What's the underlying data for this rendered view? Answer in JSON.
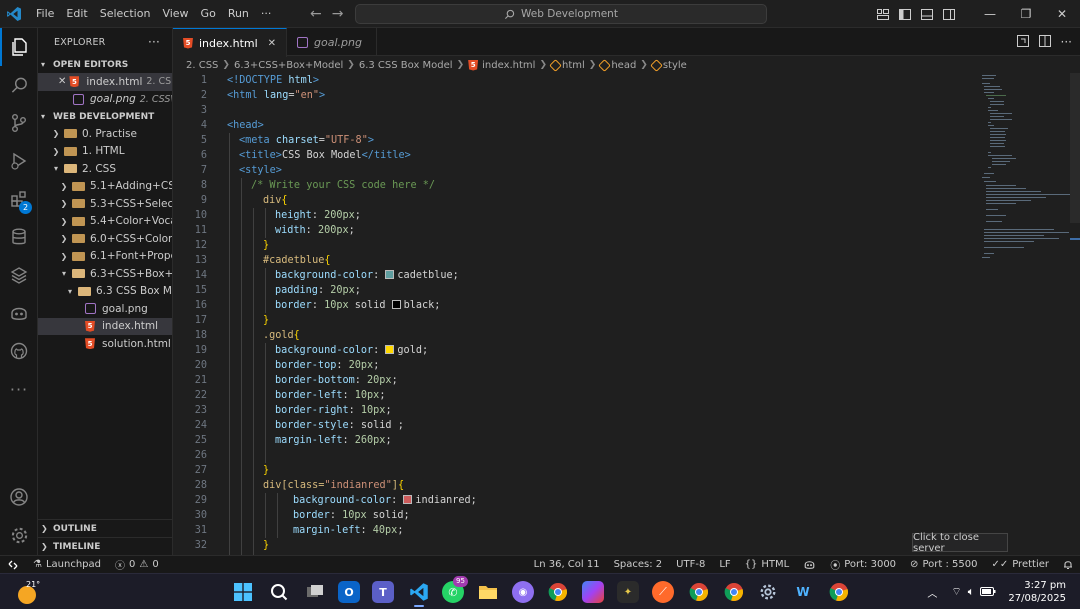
{
  "menu": [
    "File",
    "Edit",
    "Selection",
    "View",
    "Go",
    "Run",
    "···"
  ],
  "search": {
    "text": "Web Development"
  },
  "explorer": {
    "header": "EXPLORER",
    "open_editors_label": "OPEN EDITORS",
    "open_editors": [
      {
        "name": "index.html",
        "desc": "2. CS..."
      },
      {
        "name": "goal.png",
        "desc": "2. CSS\\..."
      }
    ],
    "workspace_label": "WEB DEVELOPMENT",
    "tree": [
      "0. Practise",
      "1. HTML",
      "2. CSS",
      "5.1+Adding+CSS",
      "5.3+CSS+Select...",
      "5.4+Color+Voca...",
      "6.0+CSS+Colors",
      "6.1+Font+Prope...",
      "6.3+CSS+Box+...",
      "6.3 CSS Box M...",
      "goal.png",
      "index.html",
      "solution.html"
    ],
    "outline_label": "OUTLINE",
    "timeline_label": "TIMELINE"
  },
  "tabs": [
    {
      "label": "index.html",
      "close": "✕"
    },
    {
      "label": "goal.png"
    }
  ],
  "breadcrumbs": [
    "2. CSS",
    "6.3+CSS+Box+Model",
    "6.3 CSS Box Model",
    "index.html",
    "html",
    "head",
    "style"
  ],
  "code": {
    "line_numbers": [
      "1",
      "2",
      "3",
      "4",
      "5",
      "6",
      "7",
      "8",
      "9",
      "10",
      "11",
      "12",
      "13",
      "14",
      "15",
      "16",
      "17",
      "18",
      "19",
      "20",
      "21",
      "22",
      "23",
      "24",
      "25",
      "26",
      "27",
      "28",
      "29",
      "30",
      "31",
      "32"
    ],
    "doctype_open": "<!DOCTYPE",
    "doctype_name": " html",
    "doctype_close": ">",
    "l2_open": "<html",
    "l2_attr": " lang",
    "l2_eq": "=",
    "l2_val": "\"en\"",
    "l2_close": ">",
    "l4": "<head>",
    "l5_open": "<meta",
    "l5_attr": " charset",
    "l5_eq": "=",
    "l5_val": "\"UTF-8\"",
    "l5_close": ">",
    "l6_open": "<title>",
    "l6_text": "CSS Box Model",
    "l6_close": "</title>",
    "l7": "<style>",
    "l8": "/* Write your CSS code here */",
    "sel_div": "div",
    "brace_open": "{",
    "brace_close": "}",
    "p_height": "height",
    "p_width": "width",
    "colon": ": ",
    "semi": ";",
    "v200": "200",
    "px": "px",
    "sel_cadet": "#cadetblue",
    "p_bgcolor": "background-color",
    "v_cadet": "cadetblue",
    "p_padding": "padding",
    "v20": "20",
    "p_border": "border",
    "v10": "10",
    "kw_solid": " solid ",
    "v_black": "black",
    "sel_gold": ".gold",
    "v_gold": "gold",
    "p_border_top": "border-top",
    "p_border_bottom": "border-bottom",
    "p_border_left": "border-left",
    "p_border_right": "border-right",
    "p_border_style": "border-style",
    "kw_solid2": "solid ",
    "p_margin_left": "margin-left",
    "v260": "260",
    "sel_div2": "div",
    "attr_open": "[",
    "attr_name": "class",
    "attr_eq": "=",
    "attr_val": "\"indianred\"",
    "attr_close": "]",
    "v_indianred": "indianred",
    "kw_solid3": " solid",
    "v40": "40"
  },
  "colors": {
    "cadetblue": "#5f9ea0",
    "black": "#000000",
    "gold": "#ffd700",
    "indianred": "#cd5c5c"
  },
  "tooltip": "Click to close server",
  "status": {
    "launchpad": "Launchpad",
    "problems": "0",
    "warnings": "0",
    "position": "Ln 36, Col 11",
    "spaces": "Spaces: 2",
    "encoding": "UTF-8",
    "eol": "LF",
    "language": "HTML",
    "port1": "Port: 3000",
    "port2": "Port : 5500",
    "prettier": "Prettier"
  },
  "taskbar": {
    "temp": "21°",
    "whatsapp_badge": "95",
    "time": "3:27 pm",
    "date": "27/08/2025"
  }
}
